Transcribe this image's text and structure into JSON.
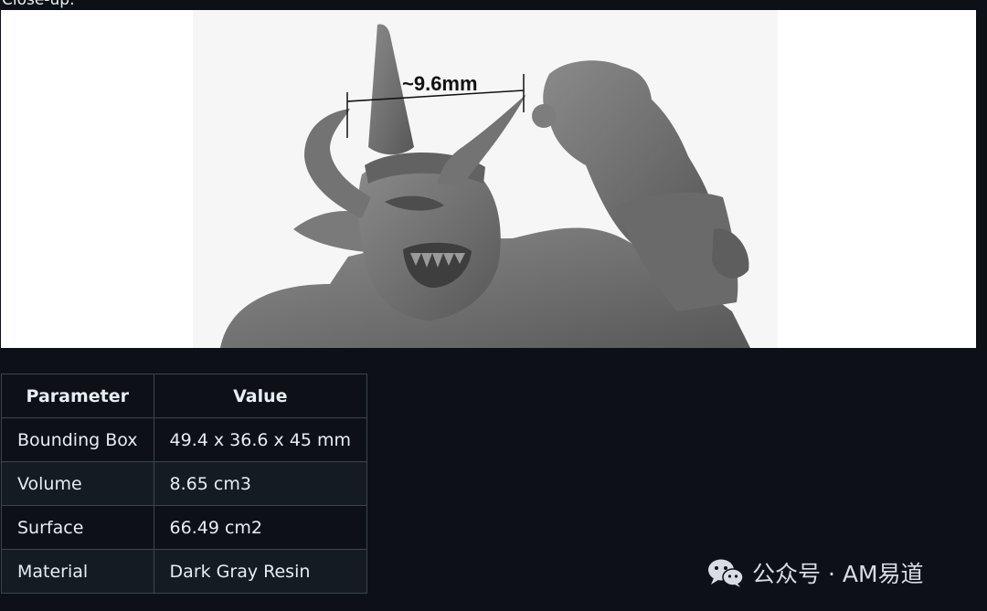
{
  "caption": "Close-up:",
  "photo": {
    "measurement_label": "~9.6mm"
  },
  "params_table": {
    "headers": [
      "Parameter",
      "Value"
    ],
    "rows": [
      {
        "parameter": "Bounding Box",
        "value": "49.4 x 36.6 x 45 mm"
      },
      {
        "parameter": "Volume",
        "value": "8.65 cm3"
      },
      {
        "parameter": "Surface",
        "value": "66.49 cm2"
      },
      {
        "parameter": "Material",
        "value": "Dark Gray Resin"
      }
    ]
  },
  "watermark": {
    "text": "公众号 · AM易道",
    "icon": "wechat-icon"
  },
  "colors": {
    "background": "#0d1117",
    "table_border": "#3d444d",
    "table_alt_row": "#151b23",
    "model_resin": "#6e6e6e"
  }
}
